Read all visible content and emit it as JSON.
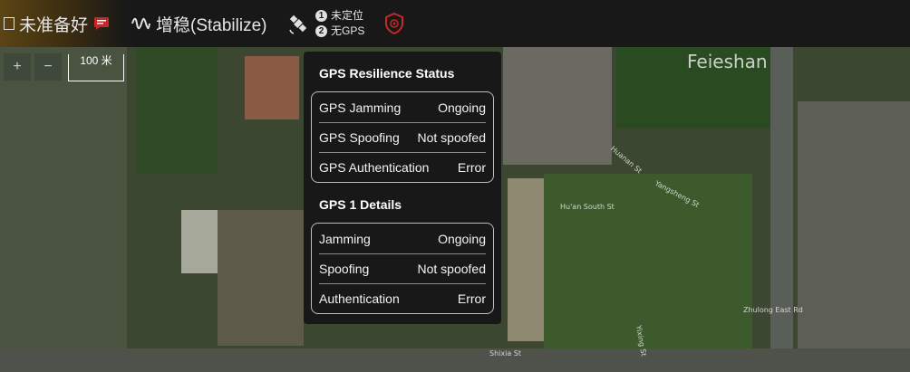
{
  "topbar": {
    "status_text": "未准备好",
    "mode_text": "增稳(Stabilize)",
    "gps_count_1": "1",
    "gps_count_2": "2",
    "gps_status_1": "未定位",
    "gps_status_2": "无GPS"
  },
  "map": {
    "zoom_in": "+",
    "zoom_out": "−",
    "scale_label": "100 米",
    "place_label": "Feieshan",
    "road_labels": [
      "Hu'an South St",
      "Yangsheng St",
      "Zhulong East Rd",
      "Shixia St",
      "Yixing St",
      "Huanan St"
    ]
  },
  "gps_panel": {
    "resilience_title": "GPS Resilience Status",
    "resilience_rows": [
      {
        "label": "GPS Jamming",
        "value": "Ongoing"
      },
      {
        "label": "GPS Spoofing",
        "value": "Not spoofed"
      },
      {
        "label": "GPS Authentication",
        "value": "Error"
      }
    ],
    "details_title": "GPS 1 Details",
    "details_rows": [
      {
        "label": "Jamming",
        "value": "Ongoing"
      },
      {
        "label": "Spoofing",
        "value": "Not spoofed"
      },
      {
        "label": "Authentication",
        "value": "Error"
      }
    ]
  },
  "colors": {
    "topbar_bg": "#181818",
    "alert_red": "#c62828",
    "panel_bg": "#161616"
  }
}
